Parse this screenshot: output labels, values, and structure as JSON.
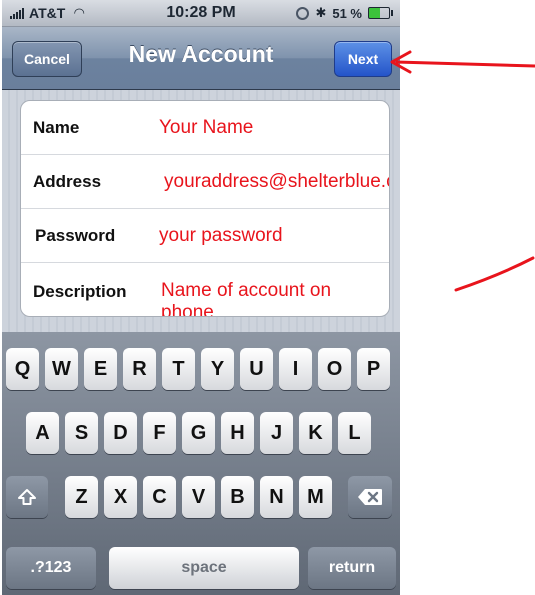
{
  "status": {
    "carrier": "AT&T",
    "time": "10:28 PM",
    "battery": "51 %",
    "battery_level": 0.51
  },
  "navbar": {
    "cancel_label": "Cancel",
    "title": "New Account",
    "next_label": "Next"
  },
  "form": {
    "rows": [
      {
        "label": "Name",
        "value": "Your Name"
      },
      {
        "label": "Address",
        "value": "youraddress@shelterblue.com"
      },
      {
        "label": "Password",
        "value": "your password"
      },
      {
        "label": "Description",
        "value": "Name of account on phone"
      }
    ]
  },
  "keyboard": {
    "row1": [
      "Q",
      "W",
      "E",
      "R",
      "T",
      "Y",
      "U",
      "I",
      "O",
      "P"
    ],
    "row2": [
      "A",
      "S",
      "D",
      "F",
      "G",
      "H",
      "J",
      "K",
      "L"
    ],
    "row3": [
      "Z",
      "X",
      "C",
      "V",
      "B",
      "N",
      "M"
    ],
    "numbers_label": ".?123",
    "space_label": "space",
    "return_label": "return",
    "shift_icon": "shift-icon",
    "backspace_icon": "backspace-icon"
  },
  "colors": {
    "annotation": "#e8141c",
    "next_button": "#2454c9",
    "navbar": "#6c829f"
  }
}
